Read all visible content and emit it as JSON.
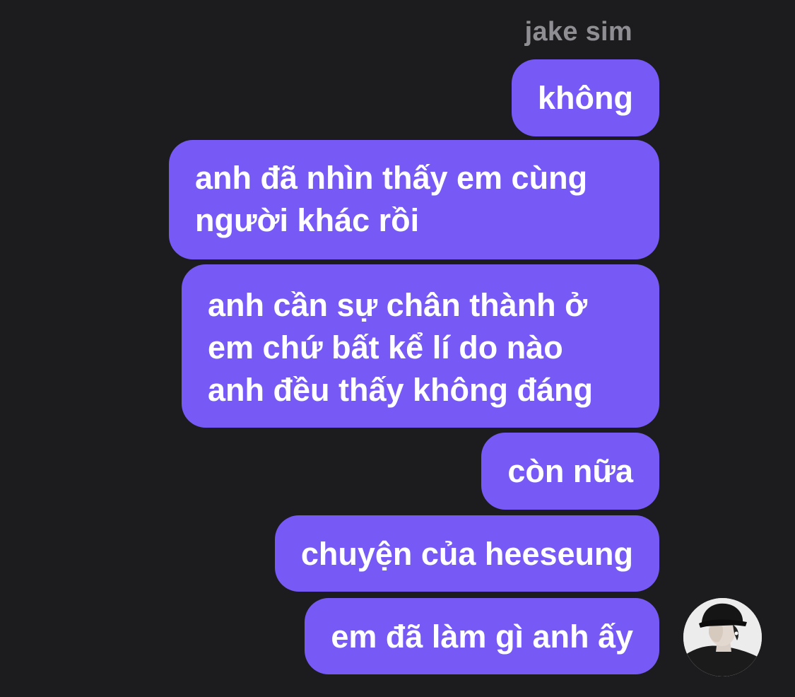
{
  "conversation": {
    "sender_name": "jake sim",
    "bubble_color": "#7759f5",
    "messages": [
      {
        "text": "không"
      },
      {
        "text": "anh đã nhìn thấy em cùng\nngười khác rồi"
      },
      {
        "text": "anh cần sự chân thành ở\nem chứ bất kể lí do nào\nanh đều thấy không đáng"
      },
      {
        "text": "còn nữa"
      },
      {
        "text": "chuyện của heeseung"
      },
      {
        "text": "em đã làm gì anh ấy"
      }
    ],
    "avatar_icon": "user-avatar-photo"
  }
}
